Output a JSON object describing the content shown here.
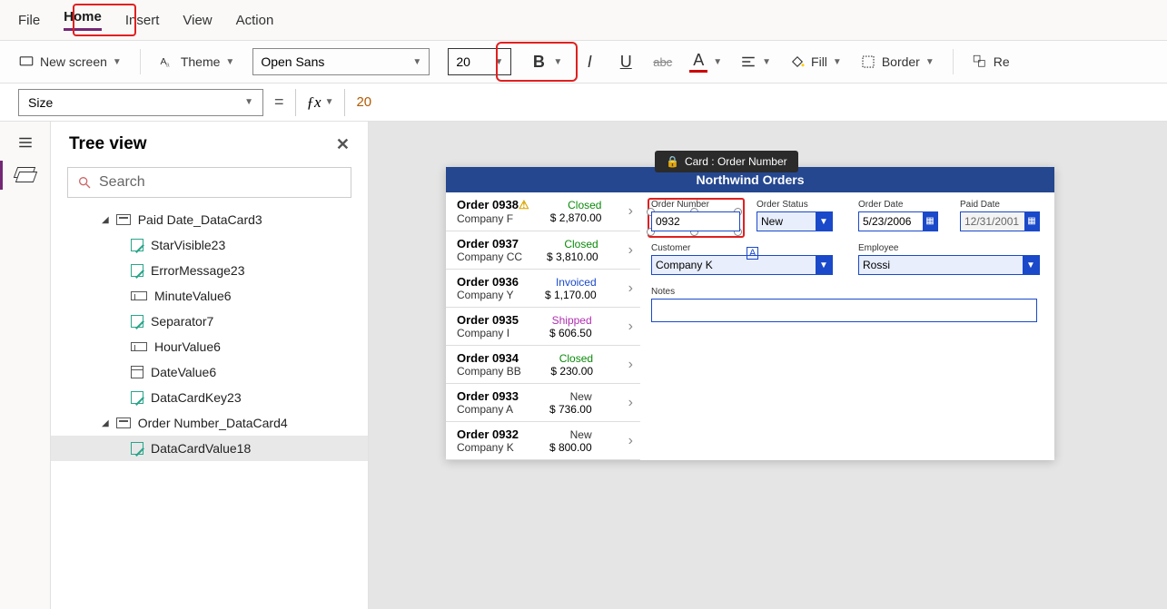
{
  "menu": {
    "file": "File",
    "home": "Home",
    "insert": "Insert",
    "view": "View",
    "action": "Action"
  },
  "toolbar": {
    "new_screen": "New screen",
    "theme": "Theme",
    "font": "Open Sans",
    "size": "20",
    "fill": "Fill",
    "border": "Border",
    "reorder": "Re"
  },
  "fxbar": {
    "property": "Size",
    "value": "20"
  },
  "tree": {
    "title": "Tree view",
    "search_ph": "Search",
    "nodes": [
      {
        "type": "card",
        "label": "Paid Date_DataCard3",
        "indent": 1,
        "caret": true
      },
      {
        "type": "edit",
        "label": "StarVisible23",
        "indent": 2
      },
      {
        "type": "edit",
        "label": "ErrorMessage23",
        "indent": 2
      },
      {
        "type": "input",
        "label": "MinuteValue6",
        "indent": 2
      },
      {
        "type": "edit",
        "label": "Separator7",
        "indent": 2
      },
      {
        "type": "input",
        "label": "HourValue6",
        "indent": 2
      },
      {
        "type": "cal",
        "label": "DateValue6",
        "indent": 2
      },
      {
        "type": "edit",
        "label": "DataCardKey23",
        "indent": 2
      },
      {
        "type": "card",
        "label": "Order Number_DataCard4",
        "indent": 1,
        "caret": true
      },
      {
        "type": "edit",
        "label": "DataCardValue18",
        "indent": 2,
        "selected": true
      }
    ]
  },
  "badge": "Card : Order Number",
  "app": {
    "title": "Northwind Orders",
    "orders": [
      {
        "num": "Order 0938",
        "co": "Company F",
        "status": "Closed",
        "amt": "$ 2,870.00",
        "warn": true
      },
      {
        "num": "Order 0937",
        "co": "Company CC",
        "status": "Closed",
        "amt": "$ 3,810.00"
      },
      {
        "num": "Order 0936",
        "co": "Company Y",
        "status": "Invoiced",
        "amt": "$ 1,170.00"
      },
      {
        "num": "Order 0935",
        "co": "Company I",
        "status": "Shipped",
        "amt": "$ 606.50"
      },
      {
        "num": "Order 0934",
        "co": "Company BB",
        "status": "Closed",
        "amt": "$ 230.00"
      },
      {
        "num": "Order 0933",
        "co": "Company A",
        "status": "New",
        "amt": "$ 736.00"
      },
      {
        "num": "Order 0932",
        "co": "Company K",
        "status": "New",
        "amt": "$ 800.00"
      }
    ],
    "labels": {
      "orderNumber": "Order Number",
      "orderStatus": "Order Status",
      "orderDate": "Order Date",
      "paidDate": "Paid Date",
      "customer": "Customer",
      "employee": "Employee",
      "notes": "Notes"
    },
    "detail": {
      "orderNumber": "0932",
      "orderStatus": "New",
      "orderDate": "5/23/2006",
      "paidDate": "12/31/2001",
      "customer": "Company K",
      "employee": "Rossi"
    }
  }
}
